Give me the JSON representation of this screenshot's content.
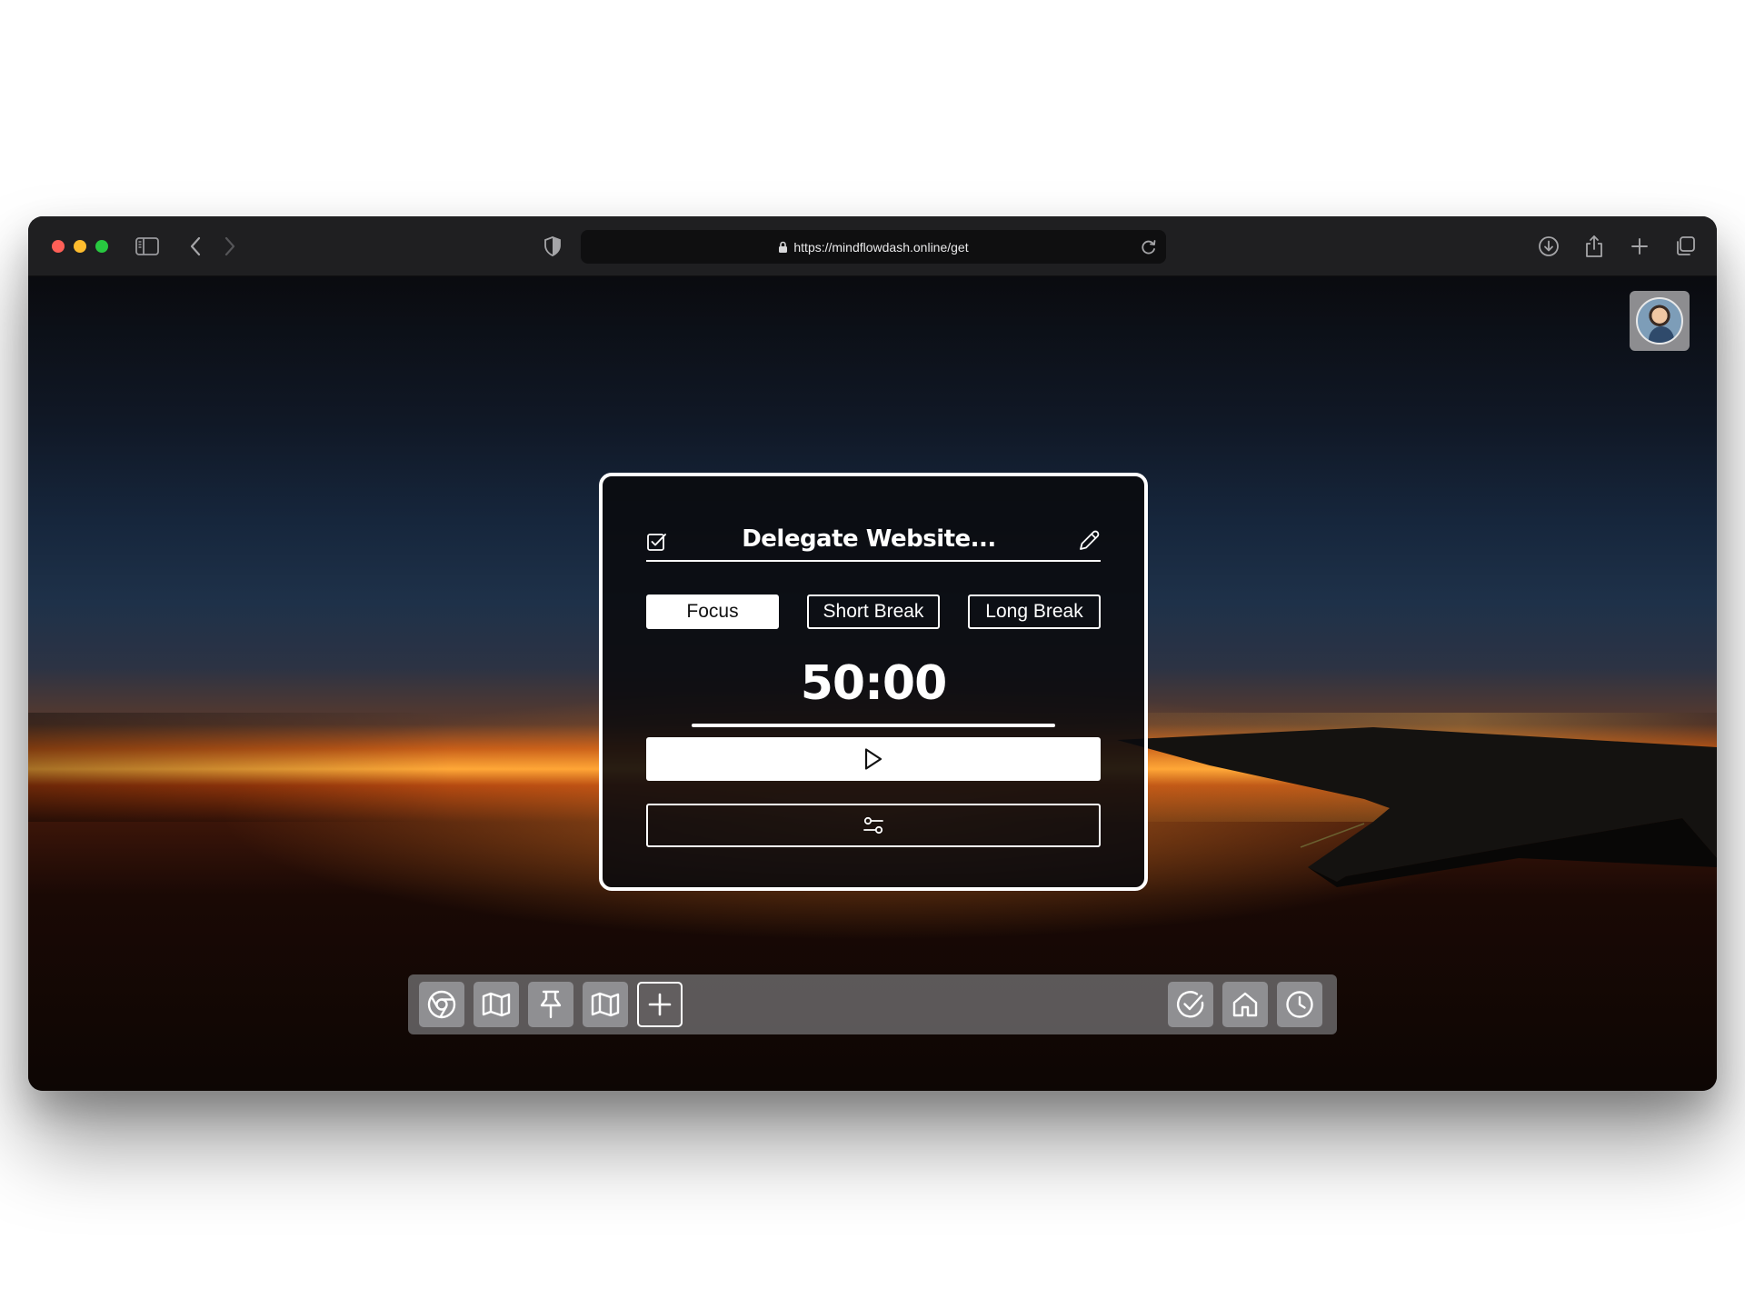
{
  "browser": {
    "url": "https://mindflowdash.online/get",
    "traffic_colors": {
      "close": "#ff5f57",
      "minimize": "#febc2e",
      "zoom": "#28c840"
    },
    "icons": {
      "sidebar": "sidebar-icon",
      "back": "chevron-left-icon",
      "forward": "chevron-right-icon",
      "shield": "privacy-shield-icon",
      "lock": "lock-icon",
      "reload": "reload-icon",
      "download": "download-icon",
      "share": "share-icon",
      "new_tab": "plus-icon",
      "tabs": "tab-overview-icon"
    }
  },
  "page": {
    "profile": {
      "icon": "avatar"
    },
    "task": {
      "title": "Delegate Website...",
      "icons": {
        "check": "checkbox-icon",
        "edit": "pencil-icon"
      }
    },
    "modes": [
      {
        "label": "Focus",
        "active": true
      },
      {
        "label": "Short Break",
        "active": false
      },
      {
        "label": "Long Break",
        "active": false
      }
    ],
    "timer": {
      "display": "50:00",
      "progress_percent": 100
    },
    "controls": {
      "play_icon": "play-icon",
      "settings_icon": "sliders-icon"
    },
    "dock": {
      "left": [
        {
          "icon": "chrome-icon"
        },
        {
          "icon": "map-icon"
        },
        {
          "icon": "pin-icon"
        },
        {
          "icon": "map-icon"
        },
        {
          "icon": "plus-icon"
        }
      ],
      "right": [
        {
          "icon": "check-circle-icon"
        },
        {
          "icon": "home-icon"
        },
        {
          "icon": "clock-icon"
        }
      ]
    },
    "colors": {
      "accent": "#ffffff",
      "card_bg": "#0a0a0e",
      "dock_bg": "#78787a",
      "dock_button": "#8f8f92",
      "toolbar_bg": "#1f1f21"
    }
  }
}
